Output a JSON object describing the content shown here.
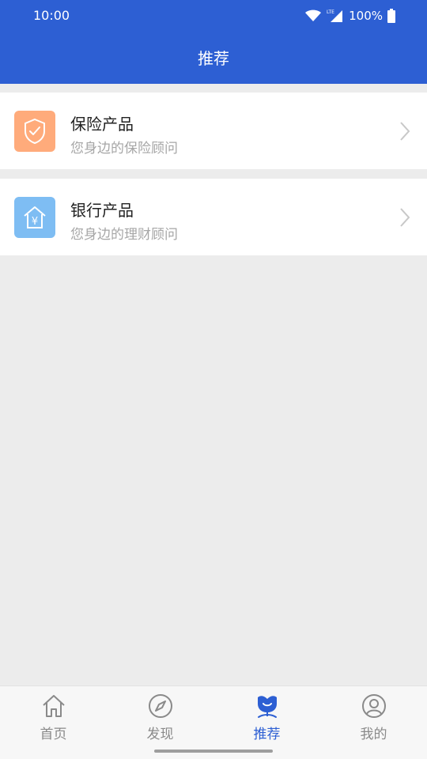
{
  "status_bar": {
    "time": "10:00",
    "battery": "100%",
    "icons": [
      "wifi-icon",
      "lte-signal-icon",
      "battery-icon"
    ]
  },
  "header": {
    "title": "推荐"
  },
  "products": [
    {
      "title": "保险产品",
      "subtitle": "您身边的保险顾问",
      "icon": "shield-icon",
      "icon_color": "#ffab7b"
    },
    {
      "title": "银行产品",
      "subtitle": "您身边的理财顾问",
      "icon": "bank-house-yen-icon",
      "icon_color": "#7ebdf3"
    }
  ],
  "bottom_nav": {
    "items": [
      {
        "label": "首页",
        "icon": "home-icon",
        "active": false
      },
      {
        "label": "发现",
        "icon": "compass-icon",
        "active": false
      },
      {
        "label": "推荐",
        "icon": "recommend-flower-icon",
        "active": true
      },
      {
        "label": "我的",
        "icon": "user-icon",
        "active": false
      }
    ]
  },
  "colors": {
    "primary": "#2d5fd3",
    "background": "#ececec",
    "inactive_nav": "#8a8a8a"
  }
}
